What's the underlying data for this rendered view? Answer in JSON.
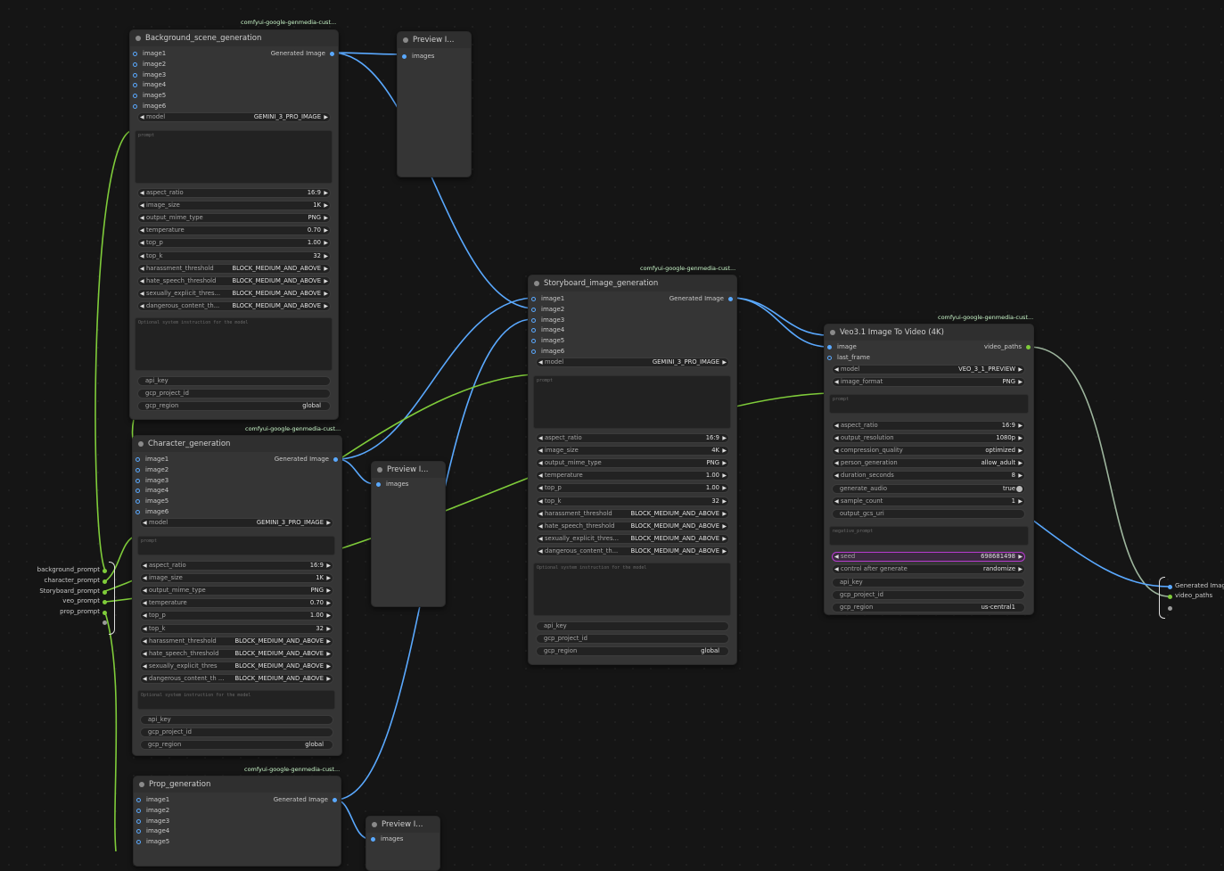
{
  "colors": {
    "link_image": "#5aa9ff",
    "link_string": "#7fcc3a",
    "link_video": "#9db59d",
    "seed_highlight": "#b83bd0"
  },
  "badge": "comfyui-google-genmedia-cust...",
  "gen_nodes": [
    {
      "title": "Background_scene_generation",
      "output": "Generated Image",
      "images": [
        "image1",
        "image2",
        "image3",
        "image4",
        "image5",
        "image6"
      ],
      "model": {
        "label": "model",
        "value": "GEMINI_3_PRO_IMAGE"
      },
      "prompt_placeholder": "prompt",
      "params": [
        [
          "aspect_ratio",
          "16:9"
        ],
        [
          "image_size",
          "1K"
        ],
        [
          "output_mime_type",
          "PNG"
        ],
        [
          "temperature",
          "0.70"
        ],
        [
          "top_p",
          "1.00"
        ],
        [
          "top_k",
          "32"
        ],
        [
          "harassment_threshold",
          "BLOCK_MEDIUM_AND_ABOVE"
        ],
        [
          "hate_speech_threshold",
          "BLOCK_MEDIUM_AND_ABOVE"
        ],
        [
          "sexually_explicit_thres...",
          "BLOCK_MEDIUM_AND_ABOVE"
        ],
        [
          "dangerous_content_th...",
          "BLOCK_MEDIUM_AND_ABOVE"
        ]
      ],
      "system_placeholder": "Optional system instruction for the model",
      "api_key": "api_key",
      "project_label": "gcp_project_id",
      "region_label": "gcp_region",
      "region_value": "global"
    },
    {
      "title": "Character_generation",
      "output": "Generated Image",
      "images": [
        "image1",
        "image2",
        "image3",
        "image4",
        "image5",
        "image6"
      ],
      "model": {
        "label": "model",
        "value": "GEMINI_3_PRO_IMAGE"
      },
      "prompt_placeholder": "prompt",
      "params": [
        [
          "aspect_ratio",
          "16:9"
        ],
        [
          "image_size",
          "1K"
        ],
        [
          "output_mime_type",
          "PNG"
        ],
        [
          "temperature",
          "0.70"
        ],
        [
          "top_p",
          "1.00"
        ],
        [
          "top_k",
          "32"
        ],
        [
          "harassment_threshold",
          "BLOCK_MEDIUM_AND_ABOVE"
        ],
        [
          "hate_speech_threshold",
          "BLOCK_MEDIUM_AND_ABOVE"
        ],
        [
          "sexually_explicit_thres",
          "BLOCK_MEDIUM_AND_ABOVE"
        ],
        [
          "dangerous_content_th ...",
          "BLOCK_MEDIUM_AND_ABOVE"
        ]
      ],
      "system_placeholder": "Optional system instruction for the model",
      "api_key": "api_key",
      "project_label": "gcp_project_id",
      "region_label": "gcp_region",
      "region_value": "global"
    },
    {
      "title": "Storyboard_image_generation",
      "output": "Generated Image",
      "images": [
        "image1",
        "image2",
        "image3",
        "image4",
        "image5",
        "image6"
      ],
      "model": {
        "label": "model",
        "value": "GEMINI_3_PRO_IMAGE"
      },
      "prompt_placeholder": "prompt",
      "params": [
        [
          "aspect_ratio",
          "16:9"
        ],
        [
          "image_size",
          "4K"
        ],
        [
          "output_mime_type",
          "PNG"
        ],
        [
          "temperature",
          "1.00"
        ],
        [
          "top_p",
          "1.00"
        ],
        [
          "top_k",
          "32"
        ],
        [
          "harassment_threshold",
          "BLOCK_MEDIUM_AND_ABOVE"
        ],
        [
          "hate_speech_threshold",
          "BLOCK_MEDIUM_AND_ABOVE"
        ],
        [
          "sexually_explicit_thres...",
          "BLOCK_MEDIUM_AND_ABOVE"
        ],
        [
          "dangerous_content_th...",
          "BLOCK_MEDIUM_AND_ABOVE"
        ]
      ],
      "system_placeholder": "Optional system instruction for the model",
      "api_key": "api_key",
      "project_label": "gcp_project_id",
      "region_label": "gcp_region",
      "region_value": "global"
    }
  ],
  "prop_node": {
    "title": "Prop_generation",
    "output": "Generated Image",
    "images": [
      "image1",
      "image2",
      "image3",
      "image4",
      "image5"
    ]
  },
  "preview": {
    "title": "Preview I...",
    "input": "images"
  },
  "veo": {
    "title": "Veo3.1 Image To Video (4K)",
    "in_image": "image",
    "in_last": "last_frame",
    "output": "video_paths",
    "model": [
      "model",
      "VEO_3_1_PREVIEW"
    ],
    "image_format": [
      "image_format",
      "PNG"
    ],
    "prompt_placeholder": "prompt",
    "params": [
      [
        "aspect_ratio",
        "16:9"
      ],
      [
        "output_resolution",
        "1080p"
      ],
      [
        "compression_quality",
        "optimized"
      ],
      [
        "person_generation",
        "allow_adult"
      ],
      [
        "duration_seconds",
        "8"
      ]
    ],
    "generate_audio": [
      "generate_audio",
      "true"
    ],
    "sample_count": [
      "sample_count",
      "1"
    ],
    "output_gcs_uri": "output_gcs_uri",
    "negative_placeholder": "negative_prompt",
    "seed": [
      "seed",
      "698681498"
    ],
    "control": [
      "control after generate",
      "randomize"
    ],
    "api_key": "api_key",
    "project_label": "gcp_project_id",
    "region_label": "gcp_region",
    "region_value": "us-central1"
  },
  "reroute_left": [
    "background_prompt",
    "character_prompt",
    "Storyboard_prompt",
    "veo_prompt",
    "prop_prompt"
  ],
  "reroute_right": [
    "Generated Image",
    "video_paths"
  ]
}
